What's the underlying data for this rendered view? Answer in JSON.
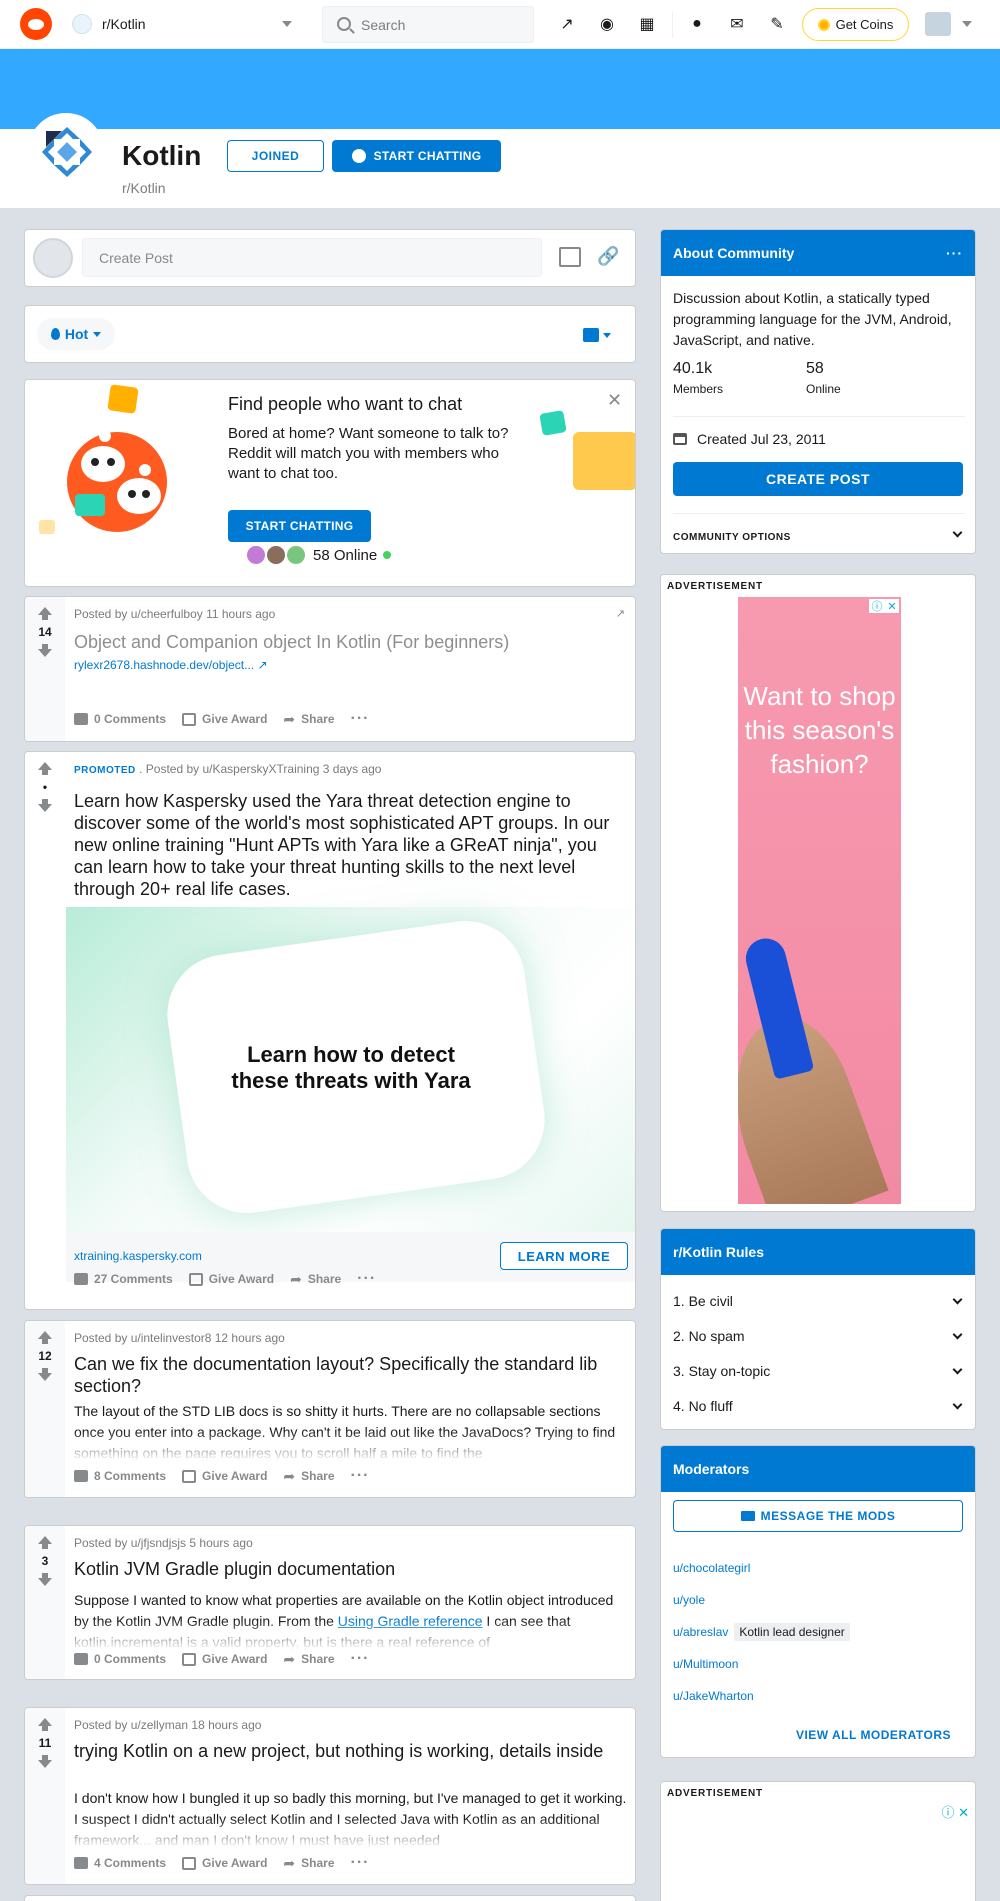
{
  "header": {
    "community": "r/Kotlin",
    "search_placeholder": "Search",
    "get_coins": "Get Coins"
  },
  "colors": {
    "brand": "#ff4500",
    "accent": "#0079d3",
    "banner": "#33a8ff"
  },
  "subreddit": {
    "name": "Kotlin",
    "slug": "r/Kotlin",
    "joined_label": "JOINED",
    "chat_label": "START CHATTING"
  },
  "create_post": {
    "placeholder": "Create Post"
  },
  "sort": {
    "label": "Hot"
  },
  "promo": {
    "title": "Find people who want to chat",
    "text": "Bored at home? Want someone to talk to? Reddit will match you with members who want to chat too.",
    "button": "START CHATTING",
    "online": "58 Online"
  },
  "posts": [
    {
      "meta": "Posted by u/cheerfulboy 11 hours ago",
      "votes": "14",
      "title": "Object and Companion object In Kotlin (For beginners)",
      "link": "rylexr2678.hashnode.dev/object...",
      "comments": "0 Comments",
      "award": "Give Award",
      "share": "Share"
    },
    {
      "promoted": "PROMOTED",
      "meta": ". Posted by u/KasperskyXTraining 3 days ago",
      "votes": "•",
      "title": "Learn how Kaspersky used the Yara threat detection engine to discover some of the world's most sophisticated APT groups. In our new online training \"Hunt APTs with Yara like a GReAT ninja\", you can learn how to take your threat hunting skills to the next level through 20+ real life cases.",
      "ad_headline": "Learn how to detect these threats with Yara",
      "ad_url": "xtraining.kaspersky.com",
      "learn_more": "LEARN MORE",
      "comments": "27 Comments",
      "award": "Give Award",
      "share": "Share"
    },
    {
      "meta": "Posted by u/intelinvestor8 12 hours ago",
      "votes": "12",
      "title": "Can we fix the documentation layout? Specifically the standard lib section?",
      "body": "The layout of the STD LIB docs is so shitty it hurts. There are no collapsable sections once you enter into a package. Why can't it be laid out like the JavaDocs? Trying to find something on the page requires you to scroll half a mile to find the",
      "comments": "8 Comments",
      "award": "Give Award",
      "share": "Share"
    },
    {
      "meta": "Posted by u/jfjsndjsjs 5 hours ago",
      "votes": "3",
      "title": "Kotlin JVM Gradle plugin documentation",
      "body_pre": "Suppose I wanted to know what properties are available on the Kotlin object introduced by the Kotlin JVM Gradle plugin. From the ",
      "body_link": "Using Gradle reference",
      "body_post": " I can see that kotlin.incremental is a valid property, but is there a real reference of",
      "comments": "0 Comments",
      "award": "Give Award",
      "share": "Share"
    },
    {
      "meta": "Posted by u/zellyman 18 hours ago",
      "votes": "11",
      "title": "trying Kotlin on a new project, but nothing is working, details inside",
      "body": "I don't know how I bungled it up so badly this morning, but I've managed to get it working. I suspect I didn't actually select Kotlin and I selected Java with Kotlin as an additional framework... and man I don't know I must have just needed",
      "comments": "4 Comments",
      "award": "Give Award",
      "share": "Share"
    }
  ],
  "about": {
    "title": "About Community",
    "description": "Discussion about Kotlin, a statically typed programming language for the JVM, Android, JavaScript, and native.",
    "members_value": "40.1k",
    "members_label": "Members",
    "online_value": "58",
    "online_label": "Online",
    "created": "Created Jul 23, 2011",
    "create_post": "CREATE POST",
    "community_options": "COMMUNITY OPTIONS"
  },
  "ad": {
    "label": "ADVERTISEMENT",
    "text": "Want to shop this season's fashion?"
  },
  "rules": {
    "title": "r/Kotlin Rules",
    "items": [
      "1. Be civil",
      "2. No spam",
      "3. Stay on-topic",
      "4. No fluff"
    ]
  },
  "moderators": {
    "title": "Moderators",
    "message_button": "MESSAGE THE MODS",
    "list": [
      {
        "name": "u/chocolategirl",
        "flair": ""
      },
      {
        "name": "u/yole",
        "flair": ""
      },
      {
        "name": "u/abreslav",
        "flair": "Kotlin lead designer"
      },
      {
        "name": "u/Multimoon",
        "flair": ""
      },
      {
        "name": "u/JakeWharton",
        "flair": ""
      }
    ],
    "view_all": "VIEW ALL MODERATORS"
  },
  "ad2": {
    "label": "ADVERTISEMENT"
  }
}
